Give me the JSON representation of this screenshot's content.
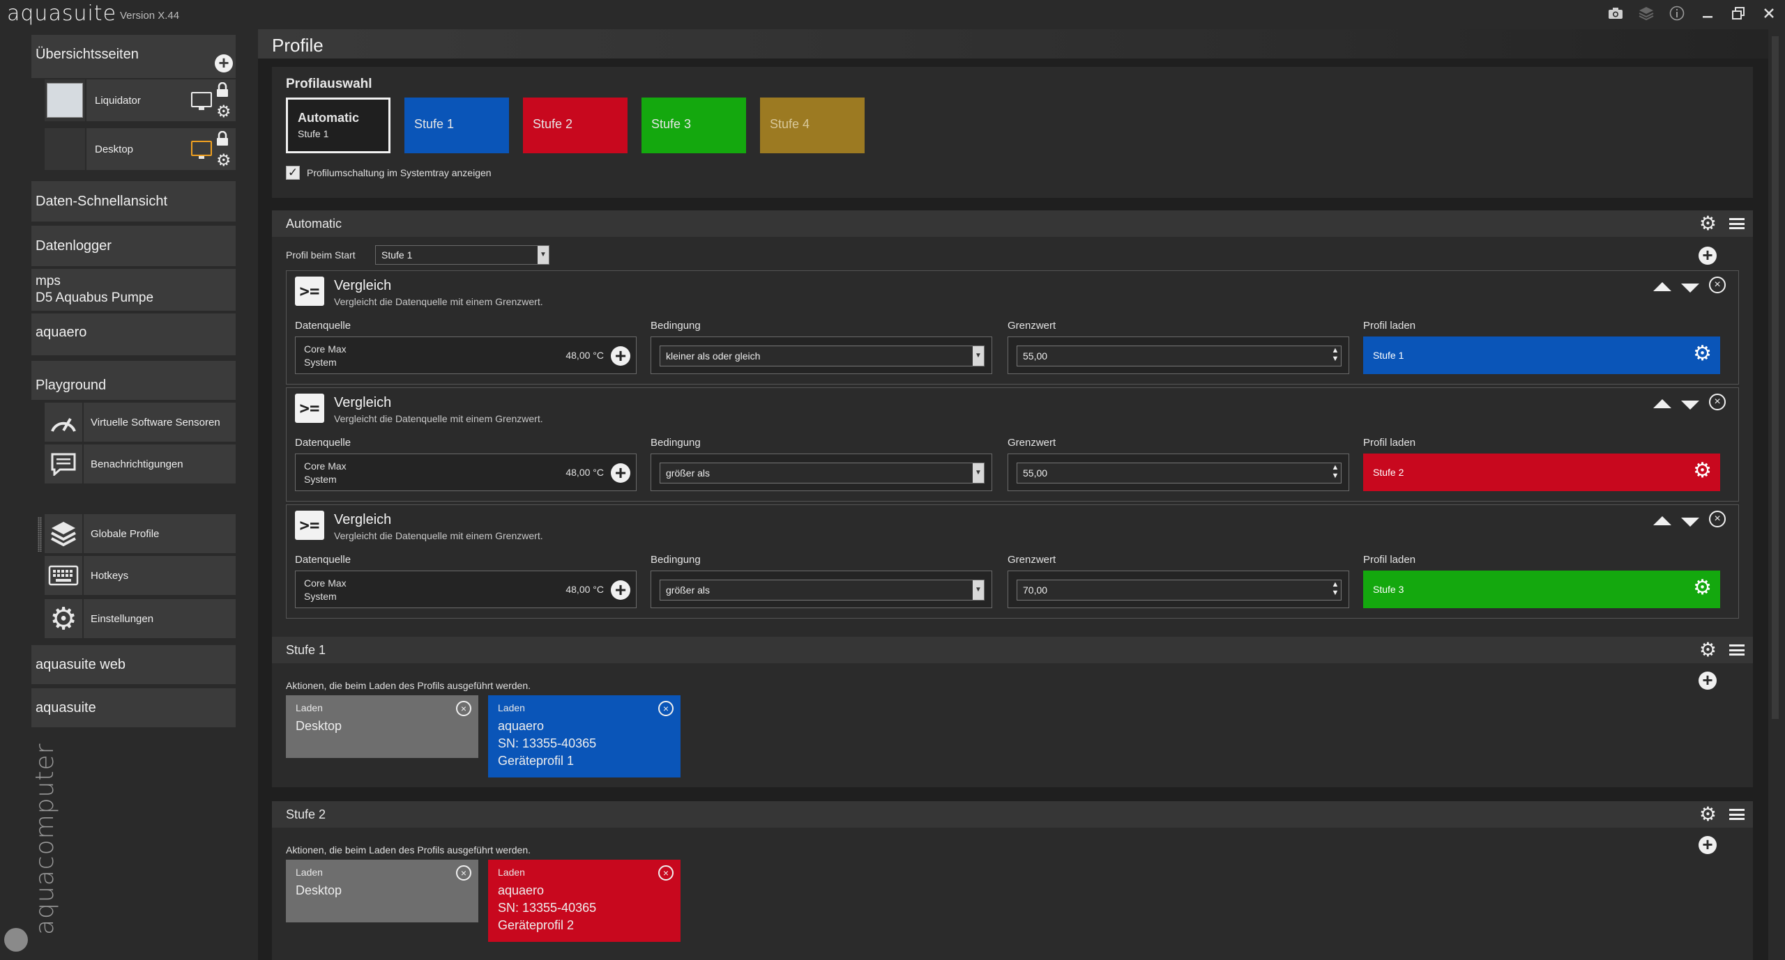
{
  "titlebar": {
    "app_name": "aquasuite",
    "version": "Version X.44",
    "icons": [
      "camera-icon",
      "layers-icon",
      "info-icon",
      "minimize-icon",
      "restore-icon",
      "close-icon"
    ]
  },
  "sidebar": {
    "overview_pages": "Übersichtsseiten",
    "pages": [
      {
        "label": "Liquidator",
        "monitor_color": "#eeeeee"
      },
      {
        "label": "Desktop",
        "monitor_color": "#f0a020"
      }
    ],
    "quick_view": "Daten-Schnellansicht",
    "data_logger": "Datenlogger",
    "mps_line1": "mps",
    "mps_line2": "D5 Aquabus Pumpe",
    "aquaero": "aquaero",
    "playground": "Playground",
    "playground_items": [
      {
        "label": "Virtuelle Software Sensoren",
        "icon": "gauge-icon"
      },
      {
        "label": "Benachrichtigungen",
        "icon": "message-icon"
      },
      {
        "label": "Globale Profile",
        "icon": "layers-icon"
      },
      {
        "label": "Hotkeys",
        "icon": "keyboard-icon"
      },
      {
        "label": "Einstellungen",
        "icon": "gear-icon"
      }
    ],
    "aquasuite_web": "aquasuite web",
    "aquasuite": "aquasuite",
    "brand": "aquacomputer"
  },
  "page": {
    "title": "Profile"
  },
  "profile_selection": {
    "title": "Profilauswahl",
    "tiles": [
      {
        "label": "Automatic",
        "sub": "Stufe 1",
        "color": "#1f1f1f"
      },
      {
        "label": "Stufe 1",
        "sub": "",
        "color": "#0a55b8"
      },
      {
        "label": "Stufe 2",
        "sub": "",
        "color": "#c8081e"
      },
      {
        "label": "Stufe 3",
        "sub": "",
        "color": "#14a80e"
      },
      {
        "label": "Stufe 4",
        "sub": "",
        "color": "#9c7a22"
      }
    ],
    "tray_checkbox_label": "Profilumschaltung im Systemtray anzeigen",
    "tray_checked": true
  },
  "automatic": {
    "title": "Automatic",
    "start_label": "Profil beim Start",
    "start_value": "Stufe 1",
    "field_labels": {
      "source": "Datenquelle",
      "condition": "Bedingung",
      "threshold": "Grenzwert",
      "profile": "Profil laden"
    },
    "rules": [
      {
        "title": "Vergleich",
        "subtitle": "Vergleicht die Datenquelle mit einem Grenzwert.",
        "source_name": "Core Max",
        "source_sub": "System",
        "source_value": "48,00 °C",
        "condition": "kleiner als oder gleich",
        "threshold": "55,00",
        "profile": "Stufe 1",
        "profile_color": "#0a55b8"
      },
      {
        "title": "Vergleich",
        "subtitle": "Vergleicht die Datenquelle mit einem Grenzwert.",
        "source_name": "Core Max",
        "source_sub": "System",
        "source_value": "48,00 °C",
        "condition": "größer als",
        "threshold": "55,00",
        "profile": "Stufe 2",
        "profile_color": "#c8081e"
      },
      {
        "title": "Vergleich",
        "subtitle": "Vergleicht die Datenquelle mit einem Grenzwert.",
        "source_name": "Core Max",
        "source_sub": "System",
        "source_value": "48,00 °C",
        "condition": "größer als",
        "threshold": "70,00",
        "profile": "Stufe 3",
        "profile_color": "#14a80e"
      }
    ]
  },
  "stufe1": {
    "title": "Stufe 1",
    "desc": "Aktionen, die beim Laden des Profils ausgeführt werden.",
    "actions": [
      {
        "label": "Laden",
        "line1": "Desktop",
        "line2": "",
        "line3": "",
        "color": "#6e6e6e"
      },
      {
        "label": "Laden",
        "line1": "aquaero",
        "line2": "SN: 13355-40365",
        "line3": "Geräteprofil 1",
        "color": "#0a55b8"
      }
    ]
  },
  "stufe2": {
    "title": "Stufe 2",
    "desc": "Aktionen, die beim Laden des Profils ausgeführt werden.",
    "actions": [
      {
        "label": "Laden",
        "line1": "Desktop",
        "line2": "",
        "line3": "",
        "color": "#6e6e6e"
      },
      {
        "label": "Laden",
        "line1": "aquaero",
        "line2": "SN: 13355-40365",
        "line3": "Geräteprofil 2",
        "color": "#c8081e"
      }
    ]
  }
}
